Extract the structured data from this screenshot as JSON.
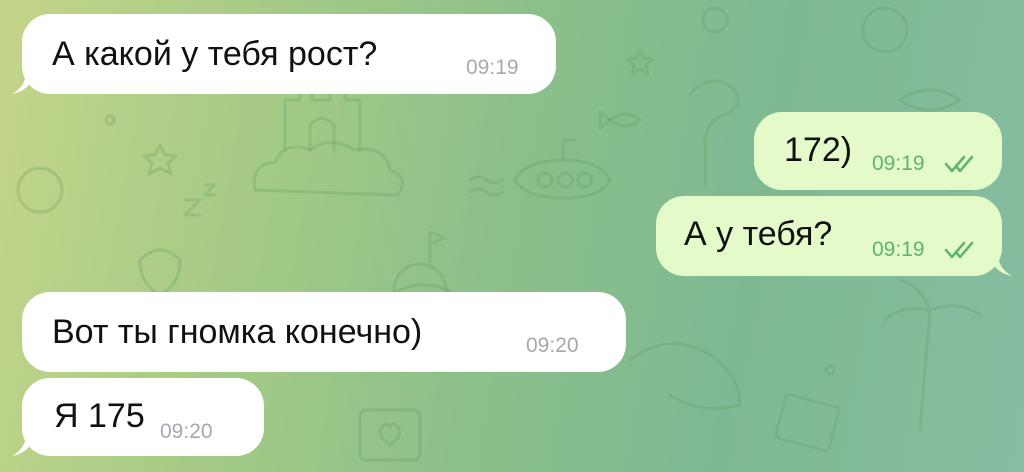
{
  "chat": {
    "messages": [
      {
        "id": "m1",
        "direction": "incoming",
        "text": "А какой у тебя рост?",
        "time": "09:19"
      },
      {
        "id": "m2",
        "direction": "outgoing",
        "text": "172)",
        "time": "09:19",
        "status": "read-double-check-icon"
      },
      {
        "id": "m3",
        "direction": "outgoing",
        "text": "А у тебя?",
        "time": "09:19",
        "status": "read-double-check-icon"
      },
      {
        "id": "m4",
        "direction": "incoming",
        "text": "Вот ты гномка конечно)",
        "time": "09:20"
      },
      {
        "id": "m5",
        "direction": "incoming",
        "text": "Я 175",
        "time": "09:20"
      }
    ]
  },
  "colors": {
    "incoming_bubble": "#ffffff",
    "outgoing_bubble": "#e4fbc9",
    "outgoing_time": "#5fb36a",
    "incoming_time": "#a4aab0",
    "wallpaper_start": "#c4d58a",
    "wallpaper_end": "#87bda1"
  }
}
